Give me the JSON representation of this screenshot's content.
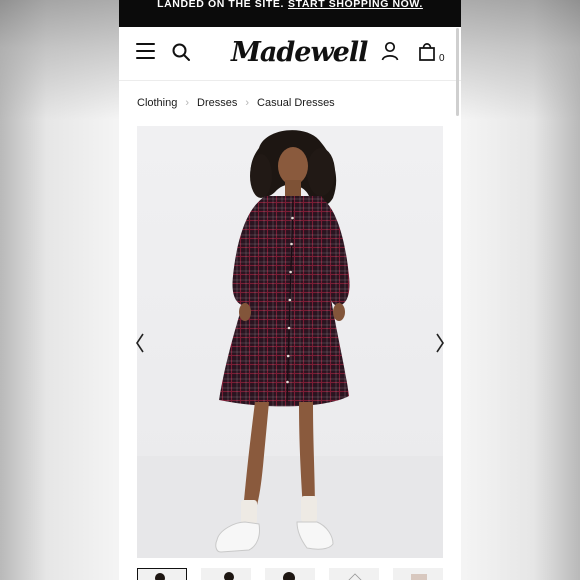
{
  "promo": {
    "text": "LANDED ON THE SITE.",
    "link_text": "START SHOPPING NOW."
  },
  "header": {
    "logo": "Madewell",
    "bag_count": "0",
    "icons": [
      "menu-icon",
      "search-icon",
      "account-icon",
      "shopping-bag-icon"
    ]
  },
  "breadcrumb": {
    "items": [
      "Clothing",
      "Dresses",
      "Casual Dresses"
    ]
  },
  "gallery": {
    "image": "model-in-plaid-button-front-mini-dress",
    "thumbnail_count": 5,
    "icons": [
      "chevron-left-icon",
      "chevron-right-icon"
    ]
  },
  "colors": {
    "promo_bg": "#0b0b0b",
    "dress_plaid": "#2a1420",
    "plaid_line": "#7a1e35"
  }
}
